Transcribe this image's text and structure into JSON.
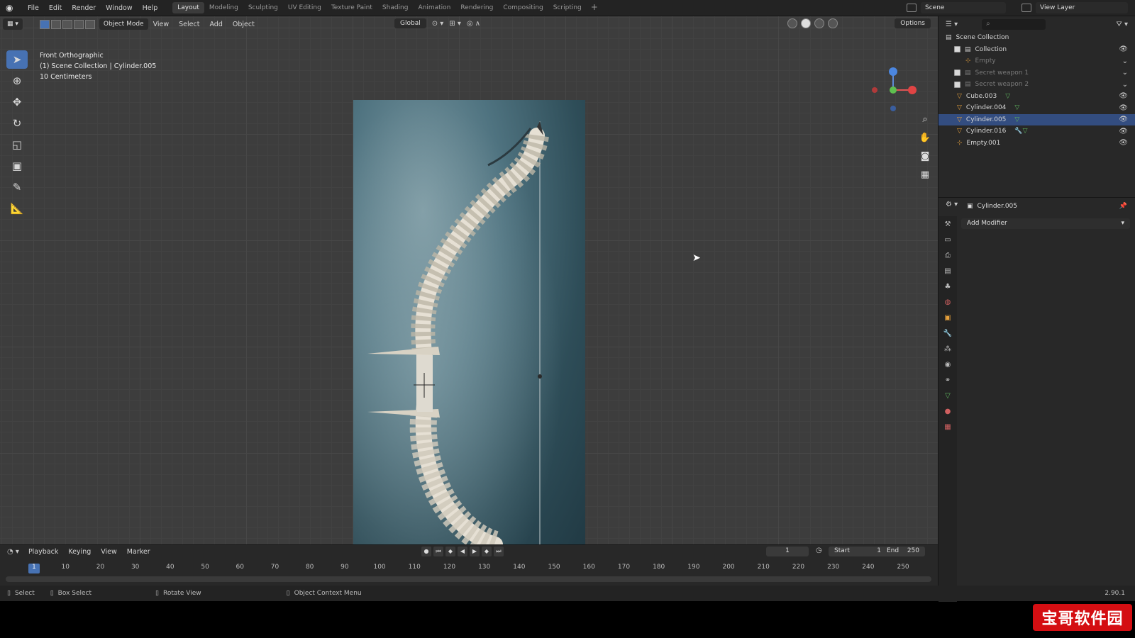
{
  "menu": [
    "File",
    "Edit",
    "Render",
    "Window",
    "Help"
  ],
  "workspaces": [
    "Layout",
    "Modeling",
    "Sculpting",
    "UV Editing",
    "Texture Paint",
    "Shading",
    "Animation",
    "Rendering",
    "Compositing",
    "Scripting"
  ],
  "active_workspace": "Layout",
  "add_tab": "+",
  "scene": "Scene",
  "view_layer": "View Layer",
  "viewport": {
    "mode": "Object Mode",
    "menus": [
      "View",
      "Select",
      "Add",
      "Object"
    ],
    "transform": "Global",
    "options": "Options",
    "info_line1": "Front Orthographic",
    "info_line2": "(1) Scene Collection | Cylinder.005",
    "info_line3": "10 Centimeters"
  },
  "outliner": {
    "root": "Scene Collection",
    "items": [
      {
        "label": "Collection",
        "visible": true
      },
      {
        "label": "Empty",
        "visible": false
      },
      {
        "label": "Secret weapon 1",
        "visible": false
      },
      {
        "label": "Secret weapon 2",
        "visible": false
      },
      {
        "label": "Cube.003",
        "visible": true
      },
      {
        "label": "Cylinder.004",
        "visible": true
      },
      {
        "label": "Cylinder.005",
        "visible": true,
        "selected": true
      },
      {
        "label": "Cylinder.016",
        "visible": true
      },
      {
        "label": "Empty.001",
        "visible": true
      }
    ]
  },
  "properties": {
    "object_name": "Cylinder.005",
    "add_modifier": "Add Modifier"
  },
  "timeline": {
    "menus": [
      "Playback",
      "Keying",
      "View",
      "Marker"
    ],
    "current_frame": "1",
    "start_label": "Start",
    "start": "1",
    "end_label": "End",
    "end": "250",
    "ticks": [
      "10",
      "20",
      "30",
      "40",
      "50",
      "60",
      "70",
      "80",
      "90",
      "100",
      "110",
      "120",
      "130",
      "140",
      "150",
      "160",
      "170",
      "180",
      "190",
      "200",
      "210",
      "220",
      "230",
      "240",
      "250"
    ]
  },
  "status": {
    "select": "Select",
    "box_select": "Box Select",
    "rotate": "Rotate View",
    "context": "Object Context Menu",
    "version": "2.90.1"
  },
  "watermark": "宝哥软件园",
  "colors": {
    "accent": "#4772b3",
    "selection": "#334d80",
    "watermark": "#d40e12"
  }
}
